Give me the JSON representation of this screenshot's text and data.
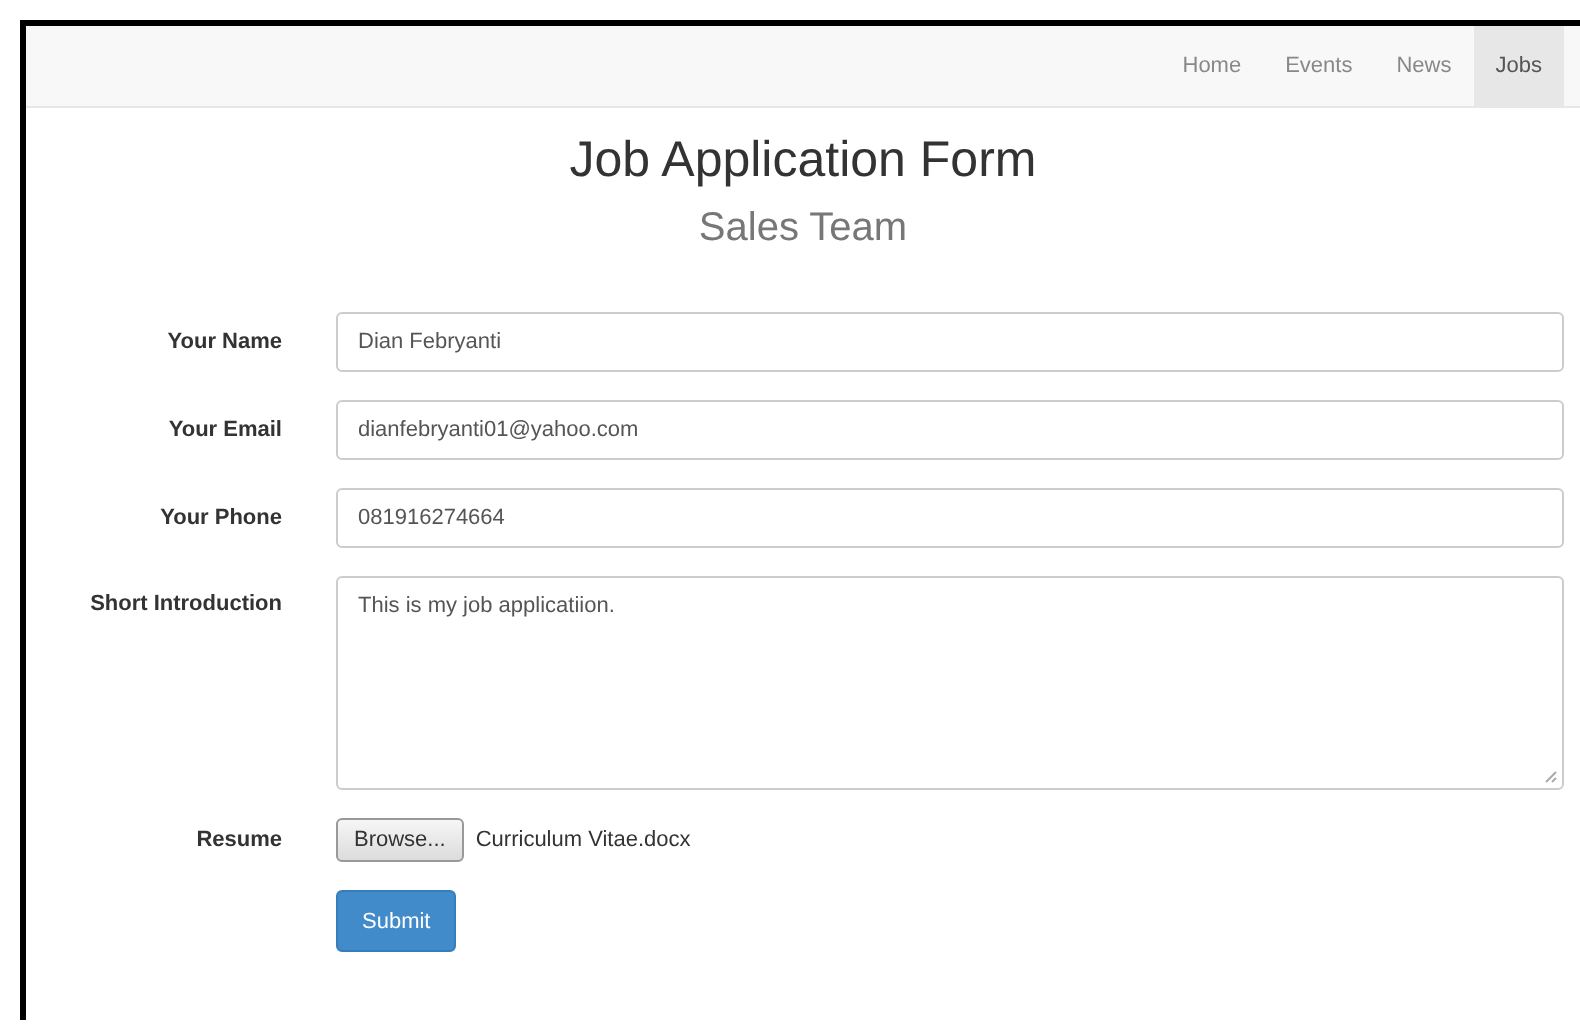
{
  "navbar": {
    "items": [
      {
        "label": "Home",
        "selected": false
      },
      {
        "label": "Events",
        "selected": false
      },
      {
        "label": "News",
        "selected": false
      },
      {
        "label": "Jobs",
        "selected": true
      }
    ]
  },
  "heading": {
    "title": "Job Application Form",
    "subtitle": "Sales Team"
  },
  "form": {
    "fields": [
      {
        "kind": "input",
        "label": "Your Name",
        "value": "Dian Febryanti"
      },
      {
        "kind": "input",
        "label": "Your Email",
        "value": "dianfebryanti01@yahoo.com"
      },
      {
        "kind": "input",
        "label": "Your Phone",
        "value": "081916274664"
      },
      {
        "kind": "textarea",
        "label": "Short Introduction",
        "value": "This is my job applicatiion."
      },
      {
        "kind": "file",
        "label": "Resume",
        "button": "Browse...",
        "value": "Curriculum Vitae.docx"
      }
    ],
    "submit": "Submit"
  }
}
